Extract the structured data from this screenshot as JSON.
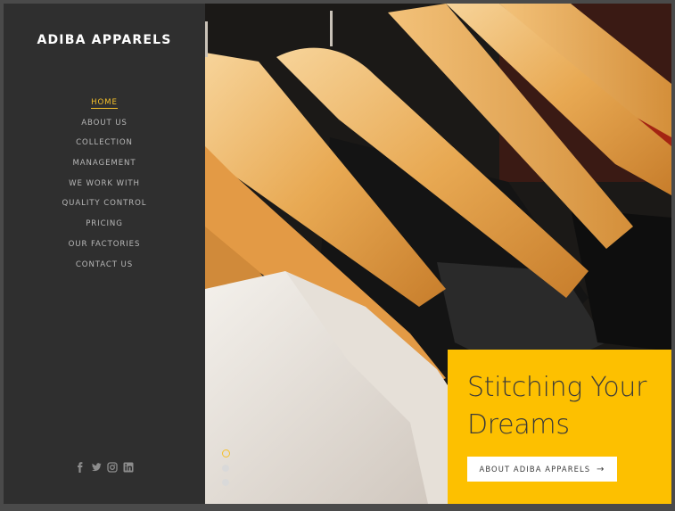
{
  "brand": {
    "name": "ADIBA APPARELS"
  },
  "nav": {
    "items": [
      {
        "label": "HOME",
        "active": true
      },
      {
        "label": "ABOUT US"
      },
      {
        "label": "COLLECTION"
      },
      {
        "label": "MANAGEMENT"
      },
      {
        "label": "WE WORK WITH"
      },
      {
        "label": "QUALITY CONTROL"
      },
      {
        "label": "PRICING"
      },
      {
        "label": "OUR FACTORIES"
      },
      {
        "label": "CONTACT US"
      }
    ]
  },
  "social": {
    "icons": [
      "facebook-icon",
      "twitter-icon",
      "instagram-icon",
      "linkedin-icon"
    ]
  },
  "slider": {
    "dots": 3,
    "active_index": 0
  },
  "hero": {
    "headline_line1": "Stitching Your",
    "headline_line2": "Dreams",
    "cta_label": "ABOUT ADIBA APPARELS",
    "cta_arrow": "→"
  },
  "colors": {
    "accent": "#fdc000",
    "sidebar": "#2f2f2f",
    "nav_text": "#b8b8b8",
    "nav_active": "#f5c02a"
  }
}
